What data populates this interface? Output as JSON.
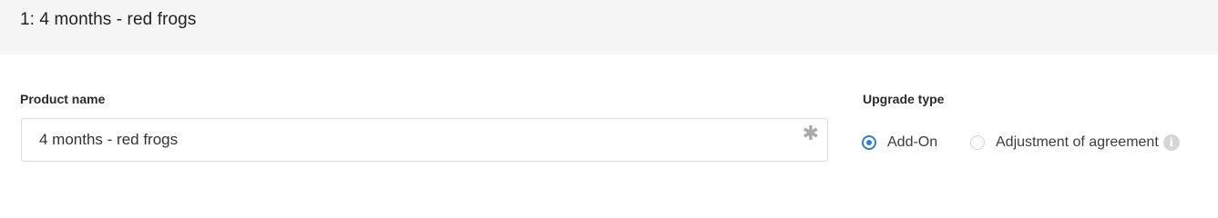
{
  "header": {
    "title": "1: 4 months - red frogs"
  },
  "product": {
    "label": "Product name",
    "value": "4 months - red frogs",
    "required_icon": "asterisk-icon",
    "required_glyph": "✱"
  },
  "upgrade": {
    "label": "Upgrade type",
    "options": [
      {
        "label": "Add-On",
        "checked": true
      },
      {
        "label": "Adjustment of agreement",
        "checked": false
      }
    ],
    "info_icon": "info-icon",
    "info_glyph": "i"
  },
  "colors": {
    "accent": "#2d7fd3",
    "header_bg": "#f5f5f5",
    "border": "#d9d9d9"
  }
}
